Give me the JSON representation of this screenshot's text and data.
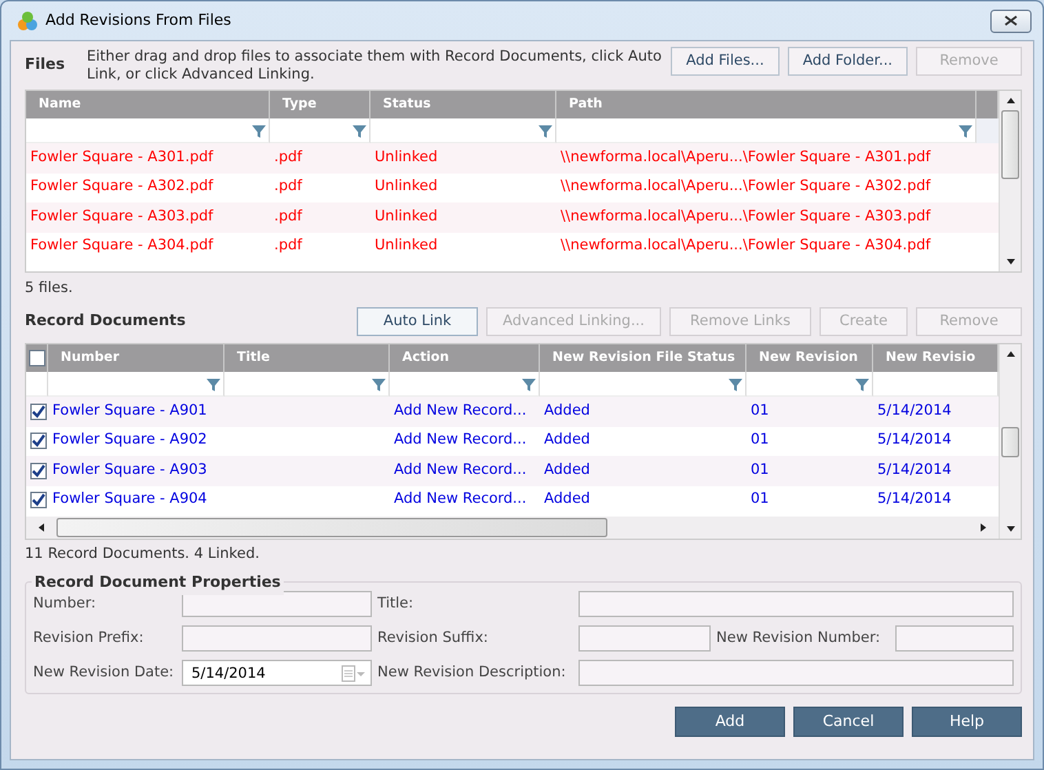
{
  "window": {
    "title": "Add Revisions From Files"
  },
  "files": {
    "label": "Files",
    "instructions": "Either drag and drop files to associate them with Record Documents, click Auto Link, or click Advanced Linking.",
    "buttons": [
      {
        "label": "Add Files...",
        "disabled": false
      },
      {
        "label": "Add Folder...",
        "disabled": false
      },
      {
        "label": "Remove",
        "disabled": true
      }
    ],
    "columns": [
      "Name",
      "Type",
      "Status",
      "Path"
    ],
    "rows": [
      {
        "name": "Fowler Square - A301.pdf",
        "type": ".pdf",
        "status": "Unlinked",
        "path": "\\\\newforma.local\\Aperu...\\Fowler Square - A301.pdf"
      },
      {
        "name": "Fowler Square - A302.pdf",
        "type": ".pdf",
        "status": "Unlinked",
        "path": "\\\\newforma.local\\Aperu...\\Fowler Square - A302.pdf"
      },
      {
        "name": "Fowler Square - A303.pdf",
        "type": ".pdf",
        "status": "Unlinked",
        "path": "\\\\newforma.local\\Aperu...\\Fowler Square - A303.pdf"
      },
      {
        "name": "Fowler Square - A304.pdf",
        "type": ".pdf",
        "status": "Unlinked",
        "path": "\\\\newforma.local\\Aperu...\\Fowler Square - A304.pdf"
      }
    ],
    "summary": "5 files."
  },
  "record_documents": {
    "label": "Record Documents",
    "buttons": [
      {
        "label": "Auto Link",
        "disabled": false
      },
      {
        "label": "Advanced Linking...",
        "disabled": true
      },
      {
        "label": "Remove Links",
        "disabled": true
      },
      {
        "label": "Create",
        "disabled": true
      },
      {
        "label": "Remove",
        "disabled": true
      }
    ],
    "select_all": {
      "checked": false
    },
    "columns": [
      "Number",
      "Title",
      "Action",
      "New Revision File Status",
      "New Revision",
      "New Revisio"
    ],
    "rows": [
      {
        "checked": true,
        "number": "Fowler Square - A901",
        "title": "",
        "action": "Add New Record...",
        "file_status": "Added",
        "revision": "01",
        "date": "5/14/2014"
      },
      {
        "checked": true,
        "number": "Fowler Square - A902",
        "title": "",
        "action": "Add New Record...",
        "file_status": "Added",
        "revision": "01",
        "date": "5/14/2014"
      },
      {
        "checked": true,
        "number": "Fowler Square - A903",
        "title": "",
        "action": "Add New Record...",
        "file_status": "Added",
        "revision": "01",
        "date": "5/14/2014"
      },
      {
        "checked": true,
        "number": "Fowler Square - A904",
        "title": "",
        "action": "Add New Record...",
        "file_status": "Added",
        "revision": "01",
        "date": "5/14/2014"
      }
    ],
    "summary": "11 Record Documents. 4 Linked."
  },
  "properties": {
    "title": "Record Document Properties",
    "rows": [
      [
        {
          "label": "Number:",
          "kind": "text"
        },
        {
          "label": "Title:",
          "kind": "text"
        }
      ],
      [
        {
          "label": "Revision Prefix:",
          "kind": "text"
        },
        {
          "label": "Revision Suffix:",
          "kind": "text"
        },
        {
          "label": "New Revision Number:",
          "kind": "text"
        }
      ],
      [
        {
          "label": "New Revision Date:",
          "kind": "date",
          "value": "5/14/2014"
        },
        {
          "label": "New Revision Description:",
          "kind": "text"
        }
      ]
    ]
  },
  "buttons": [
    "Add",
    "Cancel",
    "Help"
  ]
}
